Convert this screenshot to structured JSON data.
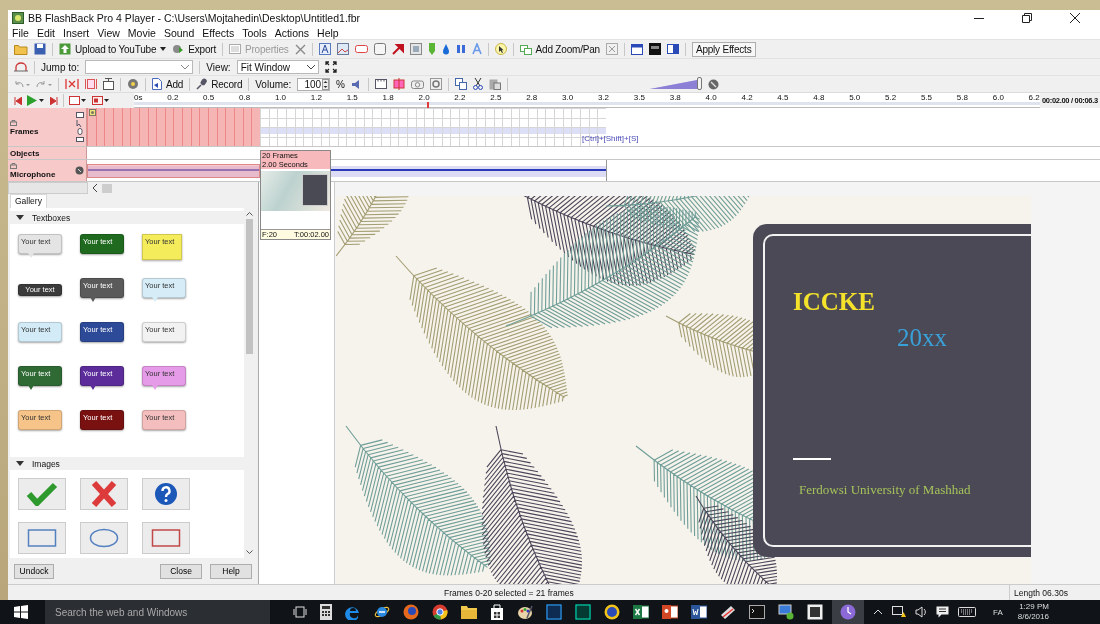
{
  "window": {
    "title": "BB FlashBack Pro 4 Player - C:\\Users\\Mojtahedin\\Desktop\\Untitled1.fbr"
  },
  "menu": [
    "File",
    "Edit",
    "Insert",
    "View",
    "Movie",
    "Sound",
    "Effects",
    "Tools",
    "Actions",
    "Help"
  ],
  "toolbar": {
    "upload": "Upload to YouTube",
    "export": "Export",
    "properties": {
      "label": "Properties",
      "disabled": true
    },
    "zoom_pan": "Add Zoom/Pan",
    "apply_effects": "Apply Effects"
  },
  "navbar": {
    "jump_label": "Jump to:",
    "view_label": "View:",
    "view_value": "Fit Window"
  },
  "editbar": {
    "add": "Add",
    "record": "Record",
    "volume_label": "Volume:",
    "volume_value": "100",
    "percent": "%",
    "volume_slider": {
      "level": 0.96
    }
  },
  "ruler": {
    "ticks": [
      "0s",
      "0.2",
      "0.5",
      "0.8",
      "1.0",
      "1.2",
      "1.5",
      "1.8",
      "2.0",
      "2.2",
      "2.5",
      "2.8",
      "3.0",
      "3.2",
      "3.5",
      "3.8",
      "4.0",
      "4.2",
      "4.5",
      "4.8",
      "5.0",
      "5.2",
      "5.5",
      "5.8",
      "6.0",
      "6.2"
    ],
    "playhead": {
      "level": 0.323
    },
    "time": "00:02.00 / 00:06.3"
  },
  "tracks": [
    {
      "kind": "frames",
      "name": "Frames",
      "selection": {
        "level": 0.333
      },
      "hint": "[Ctrl]+[Shift]+[S]"
    },
    {
      "kind": "objects",
      "name": "Objects"
    },
    {
      "kind": "audio",
      "name": "Microphone",
      "selection": {
        "level": 0.333
      }
    }
  ],
  "thumbnail": {
    "frames": "20 Frames",
    "duration": "2.00 Seconds",
    "frame": "F:20",
    "time": "T:00:02.00"
  },
  "gallery": {
    "tabs": [
      {
        "label": "Gallery",
        "selected": true
      }
    ],
    "sections": [
      {
        "kind": "textboxes",
        "title": "Textboxes",
        "expanded": true,
        "items": [
          {
            "kind": "bubble",
            "label": "Your text",
            "color": "#e4e4e4"
          },
          {
            "kind": "box",
            "label": "Your text",
            "color": "#1f6a1f"
          },
          {
            "kind": "note",
            "label": "Your text",
            "color": "#f4ec5a"
          },
          {
            "kind": "bar",
            "label": "Your text",
            "color": "#3b3b3b"
          },
          {
            "kind": "bubble",
            "label": "Your text",
            "color": "#5a5a5a"
          },
          {
            "kind": "bubble",
            "label": "Your text",
            "color": "#d6edf8"
          },
          {
            "kind": "box",
            "label": "Your text",
            "color": "#d2ebf7"
          },
          {
            "kind": "box",
            "label": "Your text",
            "color": "#2c4a98"
          },
          {
            "kind": "box",
            "label": "Your text",
            "color": "#f2f2f2"
          },
          {
            "kind": "bubble",
            "label": "Your text",
            "color": "#2f6a35"
          },
          {
            "kind": "bubble",
            "label": "Your text",
            "color": "#5b2c9a"
          },
          {
            "kind": "bubble",
            "label": "Your text",
            "color": "#e59be7"
          },
          {
            "kind": "box",
            "label": "Your text",
            "color": "#f6c488"
          },
          {
            "kind": "box",
            "label": "Your text",
            "color": "#7a1111"
          },
          {
            "kind": "box",
            "label": "Your text",
            "color": "#f4bebe"
          }
        ]
      },
      {
        "kind": "images",
        "title": "Images",
        "expanded": true
      }
    ],
    "buttons": [
      "Undock",
      "Close",
      "Help"
    ]
  },
  "slide": {
    "title": "ICCKE",
    "year": "20xx",
    "subtitle": "Ferdowsi University of Mashhad"
  },
  "status": {
    "selection": "Frames 0-20 selected = 21 frames",
    "length": "Length 06.30s"
  },
  "taskbar": {
    "search_placeholder": "Search the web and Windows",
    "language": "FA",
    "time": "1:29 PM",
    "date": "8/6/2016"
  }
}
